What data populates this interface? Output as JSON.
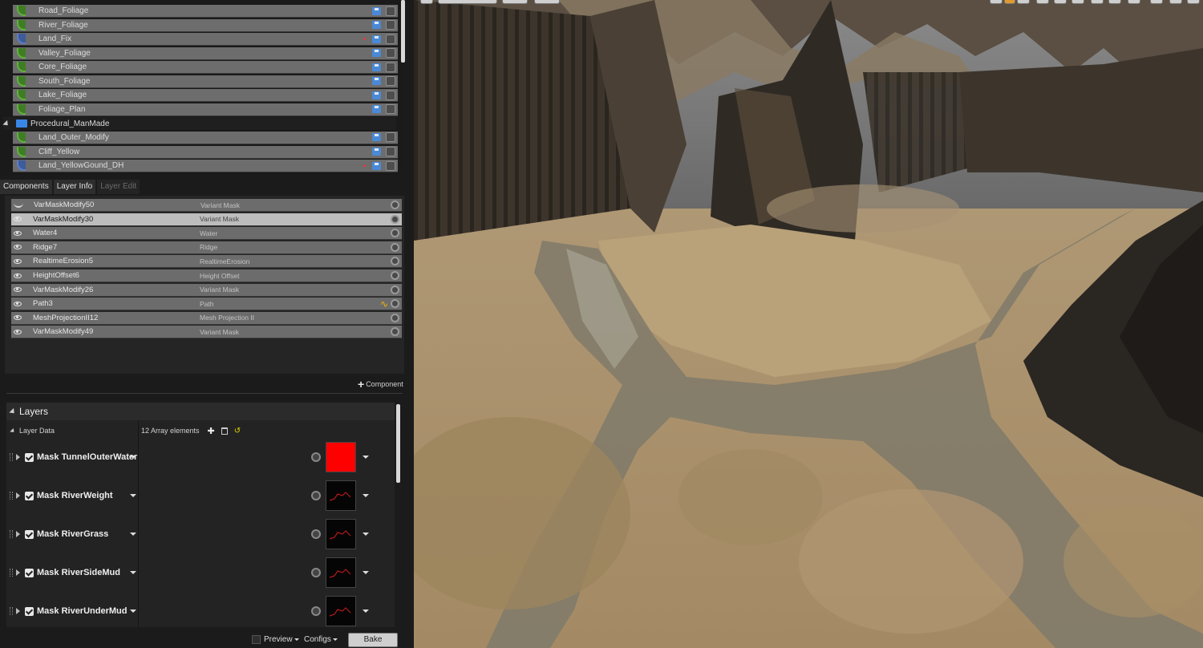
{
  "outliner": {
    "rows": [
      {
        "name": "Road_Foliage",
        "color": "green",
        "modified": false
      },
      {
        "name": "River_Foliage",
        "color": "green",
        "modified": false
      },
      {
        "name": "Land_Fix",
        "color": "blue",
        "modified": true
      },
      {
        "name": "Valley_Foliage",
        "color": "green",
        "modified": false
      },
      {
        "name": "Core_Foliage",
        "color": "green",
        "modified": false
      },
      {
        "name": "South_Foliage",
        "color": "green",
        "modified": false
      },
      {
        "name": "Lake_Foliage",
        "color": "green",
        "modified": false
      },
      {
        "name": "Foliage_Plan",
        "color": "green",
        "modified": false
      },
      {
        "name": "Procedural_ManMade",
        "folder": true
      },
      {
        "name": "Land_Outer_Modify",
        "color": "green",
        "modified": false
      },
      {
        "name": "Cliff_Yellow",
        "color": "green",
        "modified": false
      },
      {
        "name": "Land_YellowGound_DH",
        "color": "blue",
        "modified": true
      }
    ]
  },
  "tabs": {
    "components": "Components",
    "layer_info": "Layer Info",
    "layer_edit": "Layer Edit"
  },
  "components": {
    "rows": [
      {
        "name": "VarMaskModify50",
        "type": "Variant Mask",
        "visible": false
      },
      {
        "name": "VarMaskModify30",
        "type": "Variant Mask",
        "visible": true,
        "selected": true
      },
      {
        "name": "Water4",
        "type": "Water",
        "visible": true
      },
      {
        "name": "Ridge7",
        "type": "Ridge",
        "visible": true
      },
      {
        "name": "RealtimeErosion5",
        "type": "RealtimeErosion",
        "visible": true
      },
      {
        "name": "HeightOffset6",
        "type": "Height Offset",
        "visible": true
      },
      {
        "name": "VarMaskModify26",
        "type": "Variant Mask",
        "visible": true
      },
      {
        "name": "Path3",
        "type": "Path",
        "visible": true,
        "path_icon": true
      },
      {
        "name": "MeshProjectionII12",
        "type": "Mesh Projection II",
        "visible": true
      },
      {
        "name": "VarMaskModify49",
        "type": "Variant Mask",
        "visible": true
      }
    ],
    "add_label": "Component"
  },
  "layers": {
    "title": "Layers",
    "layer_data_label": "Layer Data",
    "array_count": "12 Array elements",
    "items": [
      {
        "name": "Mask TunnelOuterWater",
        "thumb": "red"
      },
      {
        "name": "Mask RiverWeight",
        "thumb": "dark"
      },
      {
        "name": "Mask RiverGrass",
        "thumb": "dark"
      },
      {
        "name": "Mask RiverSideMud",
        "thumb": "dark"
      },
      {
        "name": "Mask RiverUnderMud",
        "thumb": "dark"
      }
    ]
  },
  "bottom": {
    "preview": "Preview",
    "configs": "Configs",
    "bake": "Bake"
  }
}
